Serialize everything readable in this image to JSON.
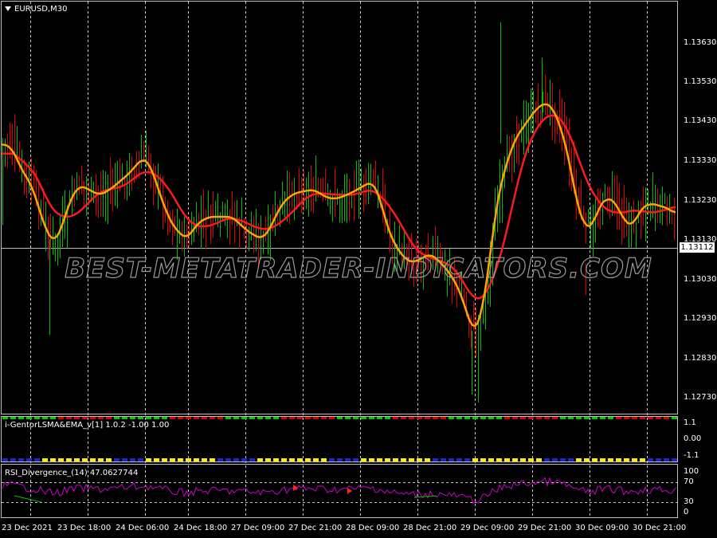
{
  "chart_title": "EURUSD,M30",
  "price_axis": {
    "ticks": [
      "1.13630",
      "1.13530",
      "1.13430",
      "1.13330",
      "1.13230",
      "1.13130",
      "1.13030",
      "1.12930",
      "1.12830",
      "1.12730"
    ],
    "current_price": "1.13112"
  },
  "watermark": "BEST-METATRADER-INDICATORS.COM",
  "indicator1": {
    "label": "i-GentorLSMA&EMA_v[1] 1.0.2 -1.00 1.00",
    "ticks": [
      "1.1",
      "0.00",
      "-1.1"
    ]
  },
  "indicator2": {
    "label": "RSI_Divergence_(14) 47.0627744",
    "ticks": [
      "100",
      "70",
      "30",
      "0"
    ]
  },
  "time_axis": [
    "23 Dec 2021",
    "23 Dec 18:00",
    "24 Dec 06:00",
    "24 Dec 18:00",
    "27 Dec 09:00",
    "27 Dec 21:00",
    "28 Dec 09:00",
    "28 Dec 21:00",
    "29 Dec 09:00",
    "29 Dec 21:00",
    "30 Dec 09:00",
    "30 Dec 21:00"
  ],
  "colors": {
    "bull": "#00c000",
    "bear": "#e00000",
    "fast_ma": "#ffa500",
    "slow_ma": "#ff1a1a",
    "rsi": "#cc00cc",
    "grid": "#c0c0c0"
  }
}
